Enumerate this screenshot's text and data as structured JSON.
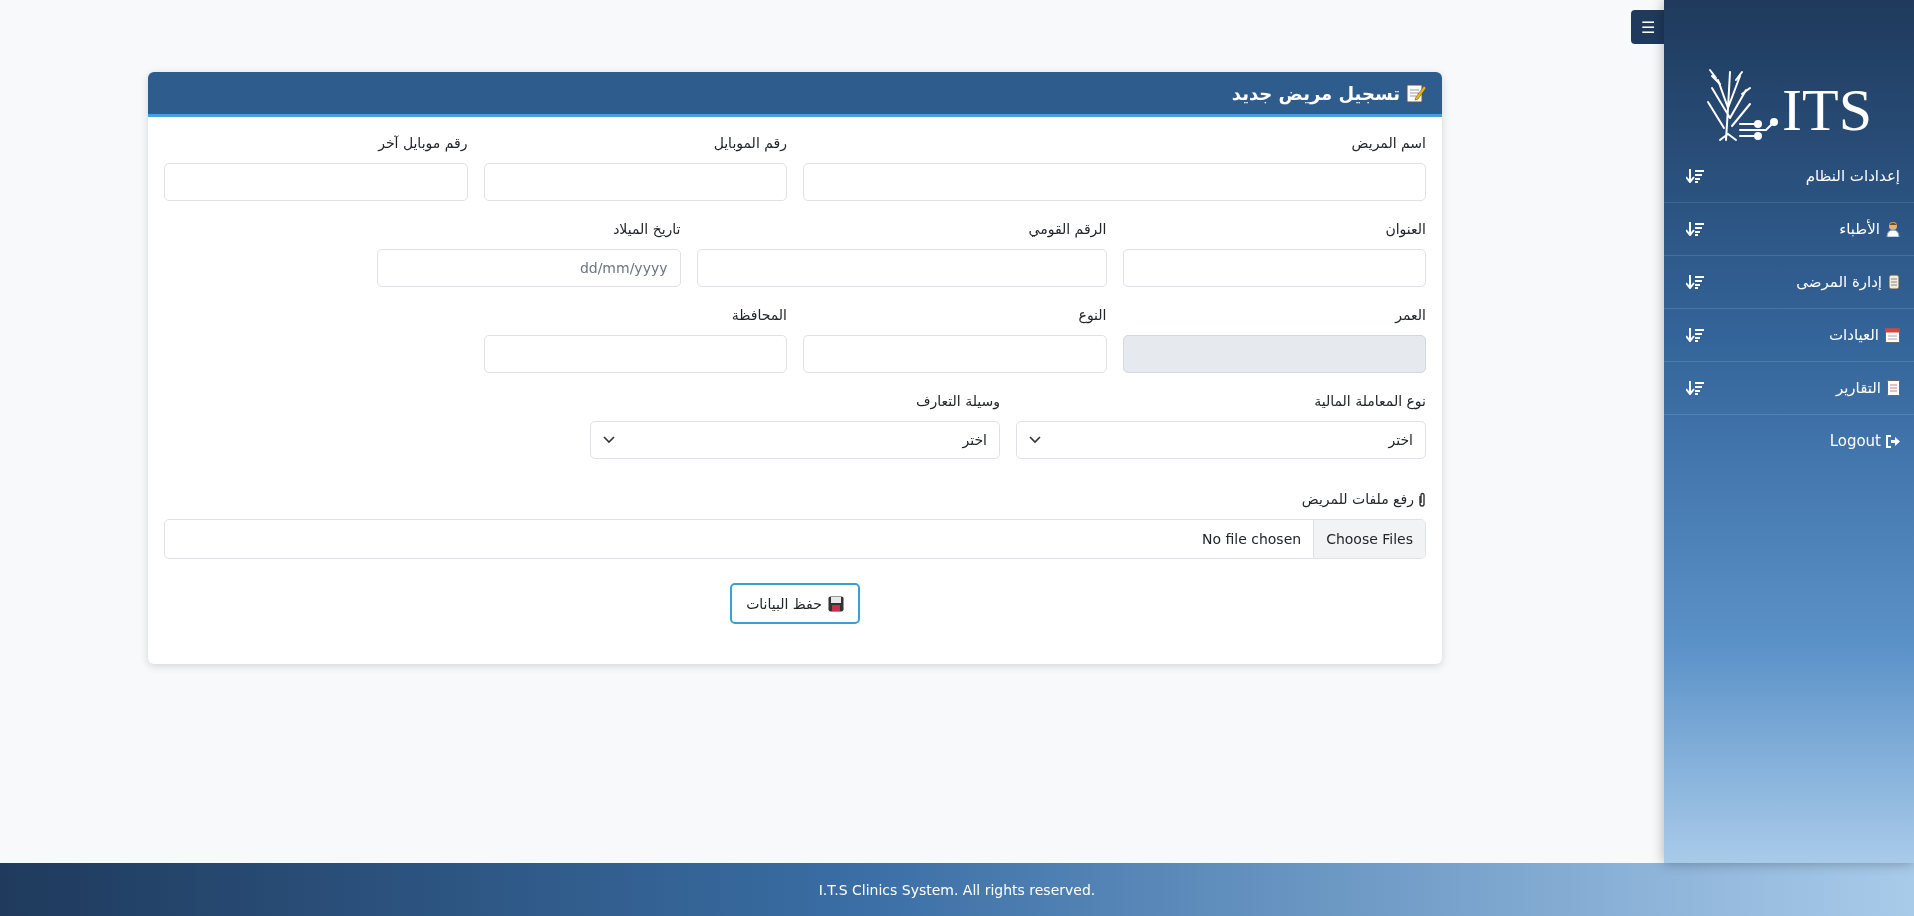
{
  "toggle_button": {
    "label": "☰"
  },
  "sidebar": {
    "logo_text": "ITS",
    "items": [
      {
        "label": "إعدادات النظام",
        "kind": "plain"
      },
      {
        "label": "الأطباء",
        "kind": "doctor"
      },
      {
        "label": "إدارة المرضى",
        "kind": "scroll"
      },
      {
        "label": "العيادات",
        "kind": "calendar"
      },
      {
        "label": "التقارير",
        "kind": "document"
      }
    ],
    "logout": {
      "label": "Logout"
    }
  },
  "form": {
    "title": "تسجيل مريض جديد",
    "rows": [
      [
        {
          "label": "اسم المريض",
          "kind": "text",
          "disabled": false
        },
        {
          "label": "رقم الموبايل",
          "kind": "text",
          "disabled": false
        },
        {
          "label": "رقم موبايل آخر",
          "kind": "text",
          "disabled": false
        }
      ],
      [
        {
          "label": "العنوان",
          "kind": "text",
          "disabled": false
        },
        {
          "label": "الرقم القومي",
          "kind": "text",
          "disabled": false
        },
        {
          "label": "تاريخ الميلاد",
          "kind": "date",
          "placeholder": "dd/mm/yyyy",
          "disabled": false
        }
      ],
      [
        {
          "label": "العمر",
          "kind": "text",
          "disabled": true
        },
        {
          "label": "النوع",
          "kind": "text",
          "disabled": false
        },
        {
          "label": "المحافظة",
          "kind": "text",
          "disabled": false
        }
      ],
      [
        {
          "label": "نوع المعاملة المالية",
          "kind": "select",
          "value": "اختر",
          "disabled": false
        },
        {
          "label": "وسيلة التعارف",
          "kind": "select",
          "value": "اختر",
          "disabled": false
        }
      ]
    ],
    "upload": {
      "label": "رفع ملفات للمريض",
      "button": "Choose Files",
      "status": "No file chosen"
    },
    "save_button": {
      "label": "حفظ البيانات"
    }
  },
  "footer": {
    "text": "I.T.S Clinics System. All rights reserved."
  }
}
